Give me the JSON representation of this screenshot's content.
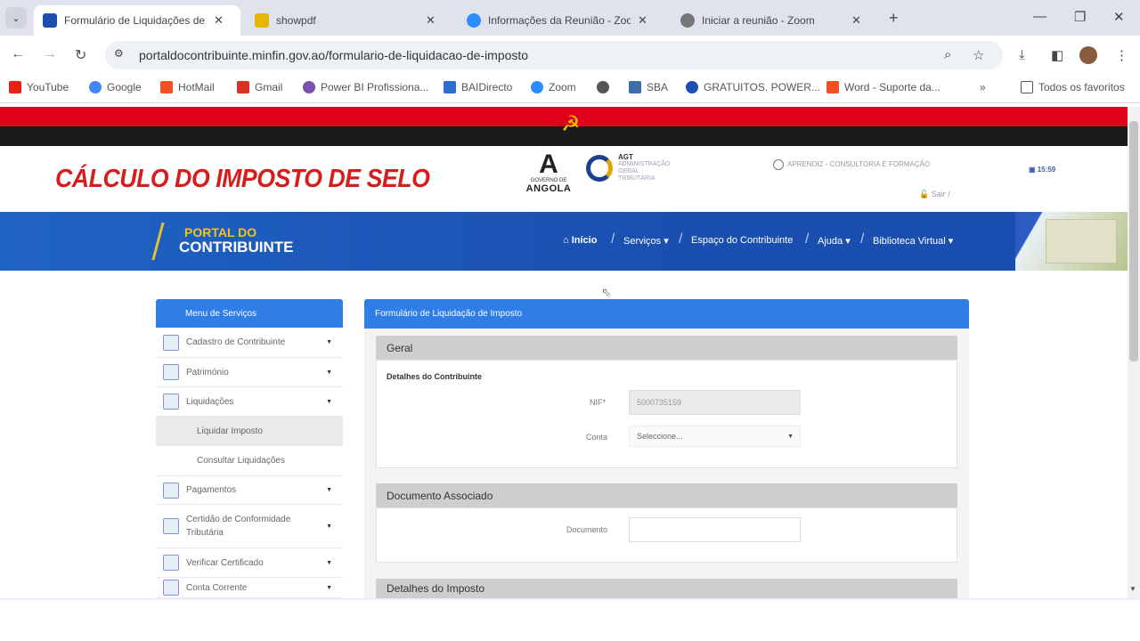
{
  "browser": {
    "tabs": [
      {
        "title": "Formulário de Liquidações de Imposto",
        "color": "#1a4fb0",
        "active": true
      },
      {
        "title": "showpdf",
        "color": "#e3b700",
        "active": false
      },
      {
        "title": "Informações da Reunião - Zoom",
        "color": "#2d8cff",
        "active": false
      },
      {
        "title": "Iniciar a reunião - Zoom",
        "color": "#777777",
        "active": false
      }
    ],
    "address": "portaldocontribuinte.minfin.gov.ao/formulario-de-liquidacao-de-imposto",
    "bookmarks": [
      {
        "label": "YouTube",
        "color": "#e62117"
      },
      {
        "label": "Google",
        "color": "#4285f4"
      },
      {
        "label": "HotMail",
        "color": "#f25022"
      },
      {
        "label": "Gmail",
        "color": "#d93025"
      },
      {
        "label": "Power BI Profissiona...",
        "color": "#7b52ab"
      },
      {
        "label": "BAIDirecto",
        "color": "#2d6fd1"
      },
      {
        "label": "Zoom",
        "color": "#2d8cff"
      },
      {
        "label": "",
        "color": "#555555"
      },
      {
        "label": "SBA",
        "color": "#3a6ea5"
      },
      {
        "label": "GRATUITOS. POWER...",
        "color": "#1a4fb0"
      },
      {
        "label": "Word - Suporte da...",
        "color": "#f25022"
      }
    ],
    "bookmarks_more": "»",
    "all_bookmarks": "Todos os favoritos"
  },
  "overlay_title": "CÁLCULO DO IMPOSTO DE SELO",
  "header": {
    "gov_small": "GOVERNO DE",
    "gov_big": "ANGOLA",
    "agt_code": "AGT",
    "agt_line1": "ADMINISTRAÇÃO",
    "agt_line2": "GERAL",
    "agt_line3": "TRIBUTÁRIA",
    "user": "APRENDIZ - CONSULTORIA E FORMAÇÃO",
    "logout": "Sair",
    "time": "15:59"
  },
  "banner": {
    "portal_sub": "PORTAL DO",
    "portal_main": "CONTRIBUINTE",
    "menu": [
      "Início",
      "Serviços",
      "Espaço do Contribuinte",
      "Ajuda",
      "Biblioteca Virtual"
    ]
  },
  "sidebar": {
    "title": "Menu de Serviços",
    "items": [
      {
        "label": "Cadastro de Contribuinte"
      },
      {
        "label": "Património"
      },
      {
        "label": "Liquidações"
      },
      {
        "label": "Pagamentos"
      },
      {
        "label": "Certidão de Conformidade Tributária"
      },
      {
        "label": "Verificar Certificado"
      },
      {
        "label": "Conta Corrente"
      }
    ],
    "subitems": [
      "Liquidar Imposto",
      "Consultar Liquidações"
    ]
  },
  "form": {
    "title": "Formulário de Liquidação de Imposto",
    "section_geral": "Geral",
    "taxpayer_details": "Detalhes do Contribuinte",
    "nif_label": "NIF*",
    "nif_value": "5000735159",
    "conta_label": "Conta",
    "conta_value": "Seleccione...",
    "section_documento": "Documento Associado",
    "documento_label": "Documento",
    "documento_value": "",
    "section_imposto": "Detalhes do Imposto"
  }
}
